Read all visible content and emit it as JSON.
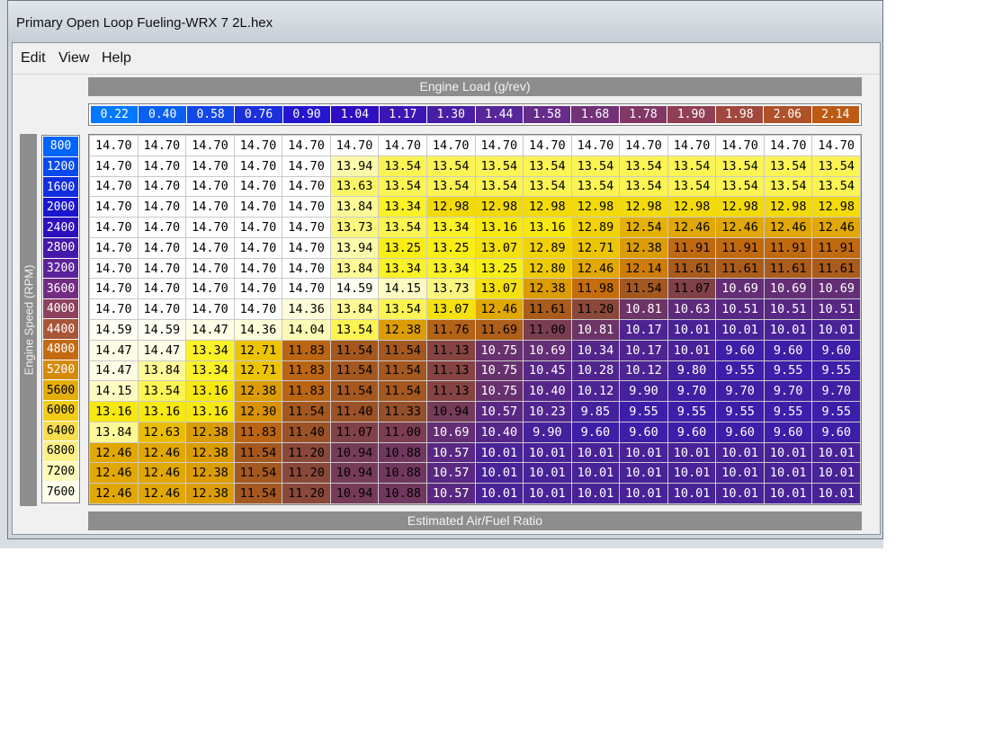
{
  "window": {
    "title": "Primary Open Loop Fueling-WRX 7 2L.hex"
  },
  "menu": [
    "Edit",
    "View",
    "Help"
  ],
  "table": {
    "column_header_label": "Engine Load (g/rev)",
    "row_header_label": "Engine Speed (RPM)",
    "value_label": "Estimated Air/Fuel Ratio",
    "load_values": [
      "0.22",
      "0.40",
      "0.58",
      "0.76",
      "0.90",
      "1.04",
      "1.17",
      "1.30",
      "1.44",
      "1.58",
      "1.68",
      "1.78",
      "1.90",
      "1.98",
      "2.06",
      "2.14"
    ],
    "rpm_values": [
      "800",
      "1200",
      "1600",
      "2000",
      "2400",
      "2800",
      "3200",
      "3600",
      "4000",
      "4400",
      "4800",
      "5200",
      "5600",
      "6000",
      "6400",
      "6800",
      "7200",
      "7600"
    ],
    "cells": [
      [
        "14.70",
        "14.70",
        "14.70",
        "14.70",
        "14.70",
        "14.70",
        "14.70",
        "14.70",
        "14.70",
        "14.70",
        "14.70",
        "14.70",
        "14.70",
        "14.70",
        "14.70",
        "14.70"
      ],
      [
        "14.70",
        "14.70",
        "14.70",
        "14.70",
        "14.70",
        "13.94",
        "13.54",
        "13.54",
        "13.54",
        "13.54",
        "13.54",
        "13.54",
        "13.54",
        "13.54",
        "13.54",
        "13.54"
      ],
      [
        "14.70",
        "14.70",
        "14.70",
        "14.70",
        "14.70",
        "13.63",
        "13.54",
        "13.54",
        "13.54",
        "13.54",
        "13.54",
        "13.54",
        "13.54",
        "13.54",
        "13.54",
        "13.54"
      ],
      [
        "14.70",
        "14.70",
        "14.70",
        "14.70",
        "14.70",
        "13.84",
        "13.34",
        "12.98",
        "12.98",
        "12.98",
        "12.98",
        "12.98",
        "12.98",
        "12.98",
        "12.98",
        "12.98"
      ],
      [
        "14.70",
        "14.70",
        "14.70",
        "14.70",
        "14.70",
        "13.73",
        "13.54",
        "13.34",
        "13.16",
        "13.16",
        "12.89",
        "12.54",
        "12.46",
        "12.46",
        "12.46",
        "12.46"
      ],
      [
        "14.70",
        "14.70",
        "14.70",
        "14.70",
        "14.70",
        "13.94",
        "13.25",
        "13.25",
        "13.07",
        "12.89",
        "12.71",
        "12.38",
        "11.91",
        "11.91",
        "11.91",
        "11.91"
      ],
      [
        "14.70",
        "14.70",
        "14.70",
        "14.70",
        "14.70",
        "13.84",
        "13.34",
        "13.34",
        "13.25",
        "12.80",
        "12.46",
        "12.14",
        "11.61",
        "11.61",
        "11.61",
        "11.61"
      ],
      [
        "14.70",
        "14.70",
        "14.70",
        "14.70",
        "14.70",
        "14.59",
        "14.15",
        "13.73",
        "13.07",
        "12.38",
        "11.98",
        "11.54",
        "11.07",
        "10.69",
        "10.69",
        "10.69"
      ],
      [
        "14.70",
        "14.70",
        "14.70",
        "14.70",
        "14.36",
        "13.84",
        "13.54",
        "13.07",
        "12.46",
        "11.61",
        "11.20",
        "10.81",
        "10.63",
        "10.51",
        "10.51",
        "10.51"
      ],
      [
        "14.59",
        "14.59",
        "14.47",
        "14.36",
        "14.04",
        "13.54",
        "12.38",
        "11.76",
        "11.69",
        "11.00",
        "10.81",
        "10.17",
        "10.01",
        "10.01",
        "10.01",
        "10.01"
      ],
      [
        "14.47",
        "14.47",
        "13.34",
        "12.71",
        "11.83",
        "11.54",
        "11.54",
        "11.13",
        "10.75",
        "10.69",
        "10.34",
        "10.17",
        "10.01",
        "9.60",
        "9.60",
        "9.60"
      ],
      [
        "14.47",
        "13.84",
        "13.34",
        "12.71",
        "11.83",
        "11.54",
        "11.54",
        "11.13",
        "10.75",
        "10.45",
        "10.28",
        "10.12",
        "9.80",
        "9.55",
        "9.55",
        "9.55"
      ],
      [
        "14.15",
        "13.54",
        "13.16",
        "12.38",
        "11.83",
        "11.54",
        "11.54",
        "11.13",
        "10.75",
        "10.40",
        "10.12",
        "9.90",
        "9.70",
        "9.70",
        "9.70",
        "9.70"
      ],
      [
        "13.16",
        "13.16",
        "13.16",
        "12.30",
        "11.54",
        "11.40",
        "11.33",
        "10.94",
        "10.57",
        "10.23",
        "9.85",
        "9.55",
        "9.55",
        "9.55",
        "9.55",
        "9.55"
      ],
      [
        "13.84",
        "12.63",
        "12.38",
        "11.83",
        "11.40",
        "11.07",
        "11.00",
        "10.69",
        "10.40",
        "9.90",
        "9.60",
        "9.60",
        "9.60",
        "9.60",
        "9.60",
        "9.60"
      ],
      [
        "12.46",
        "12.46",
        "12.38",
        "11.54",
        "11.20",
        "10.94",
        "10.88",
        "10.57",
        "10.01",
        "10.01",
        "10.01",
        "10.01",
        "10.01",
        "10.01",
        "10.01",
        "10.01"
      ],
      [
        "12.46",
        "12.46",
        "12.38",
        "11.54",
        "11.20",
        "10.94",
        "10.88",
        "10.57",
        "10.01",
        "10.01",
        "10.01",
        "10.01",
        "10.01",
        "10.01",
        "10.01",
        "10.01"
      ],
      [
        "12.46",
        "12.46",
        "12.38",
        "11.54",
        "11.20",
        "10.94",
        "10.88",
        "10.57",
        "10.01",
        "10.01",
        "10.01",
        "10.01",
        "10.01",
        "10.01",
        "10.01",
        "10.01"
      ]
    ]
  }
}
